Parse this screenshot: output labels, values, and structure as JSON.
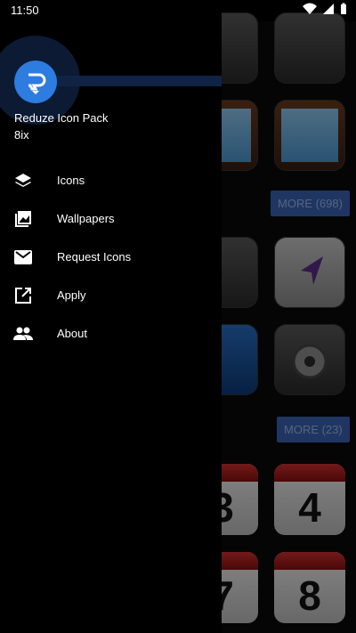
{
  "status_bar": {
    "time": "11:50"
  },
  "drawer": {
    "app_name": "Reduze Icon Pack",
    "author": "8ix",
    "menu": [
      {
        "label": "Icons",
        "icon": "layers-icon"
      },
      {
        "label": "Wallpapers",
        "icon": "image-icon"
      },
      {
        "label": "Request Icons",
        "icon": "mail-icon"
      },
      {
        "label": "Apply",
        "icon": "open-external-icon"
      },
      {
        "label": "About",
        "icon": "people-icon"
      }
    ]
  },
  "background": {
    "more_buttons": [
      "MORE (698)",
      "MORE (23)"
    ],
    "calendar_numbers": [
      "3",
      "4",
      "7",
      "8"
    ]
  }
}
